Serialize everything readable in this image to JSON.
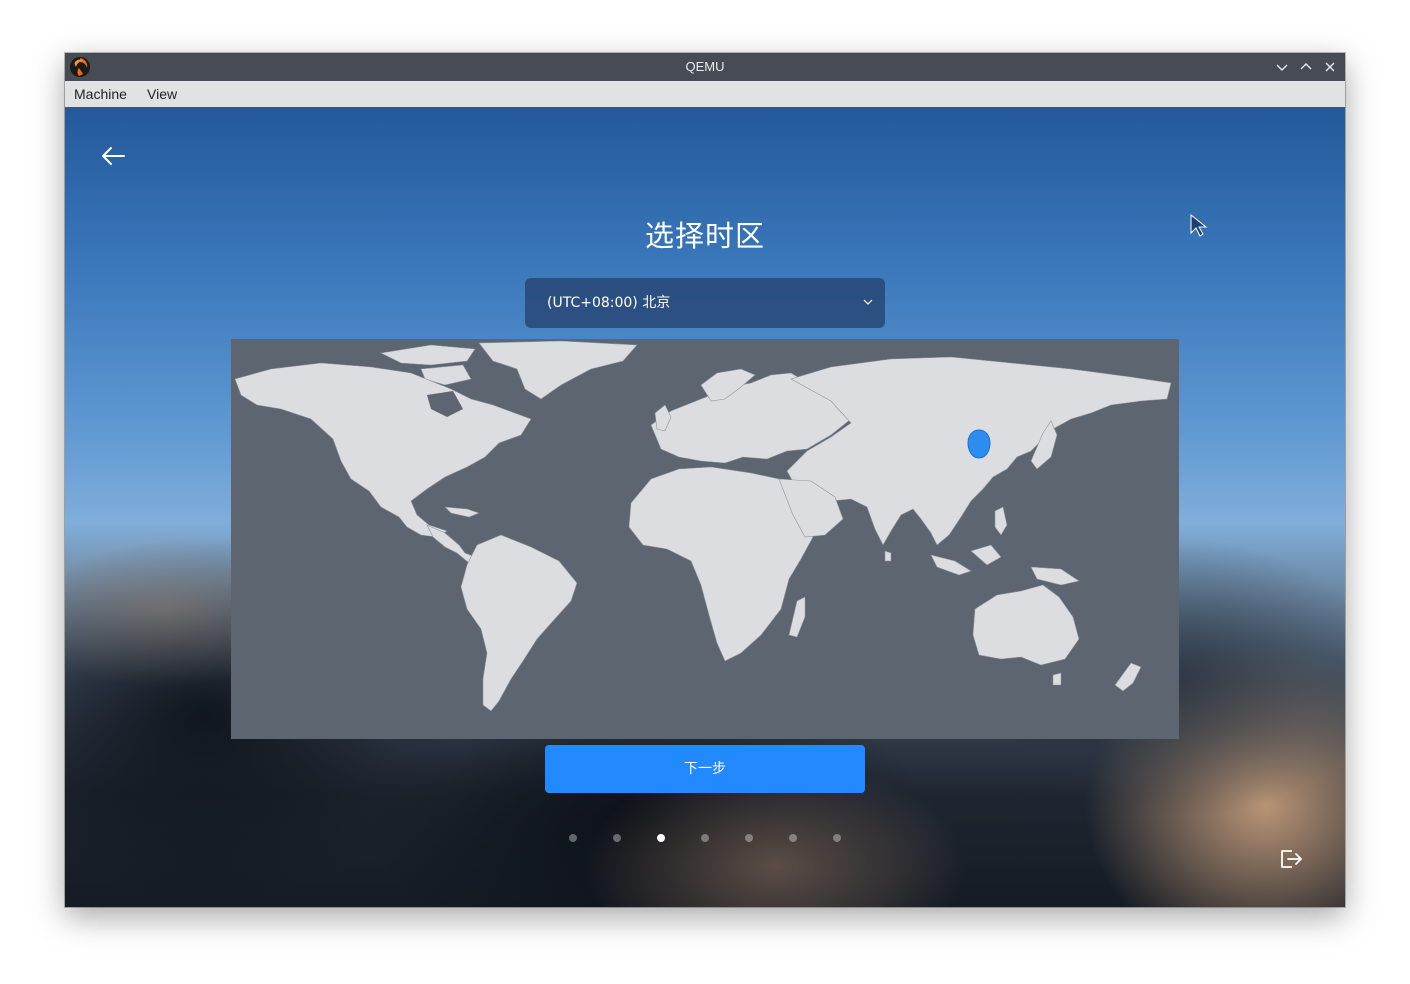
{
  "window": {
    "title": "QEMU",
    "controls": [
      "minimize-icon",
      "maximize-icon",
      "close-icon"
    ]
  },
  "menubar": {
    "items": [
      {
        "label": "Machine"
      },
      {
        "label": "View"
      }
    ]
  },
  "installer": {
    "title": "选择时区",
    "timezone": {
      "selected": "(UTC+08:00) 北京",
      "dropdown_icon": "chevron-down-icon"
    },
    "map": {
      "marker_label": "location-pin-icon"
    },
    "next_button": "下一步",
    "steps": {
      "total": 7,
      "current": 3
    },
    "icons": {
      "back": "arrow-left-icon",
      "exit": "exit-icon"
    }
  },
  "colors": {
    "accent": "#2289ff",
    "marker": "#2d8cf0",
    "map_bg": "#5c6570",
    "land": "#dcdde0"
  }
}
